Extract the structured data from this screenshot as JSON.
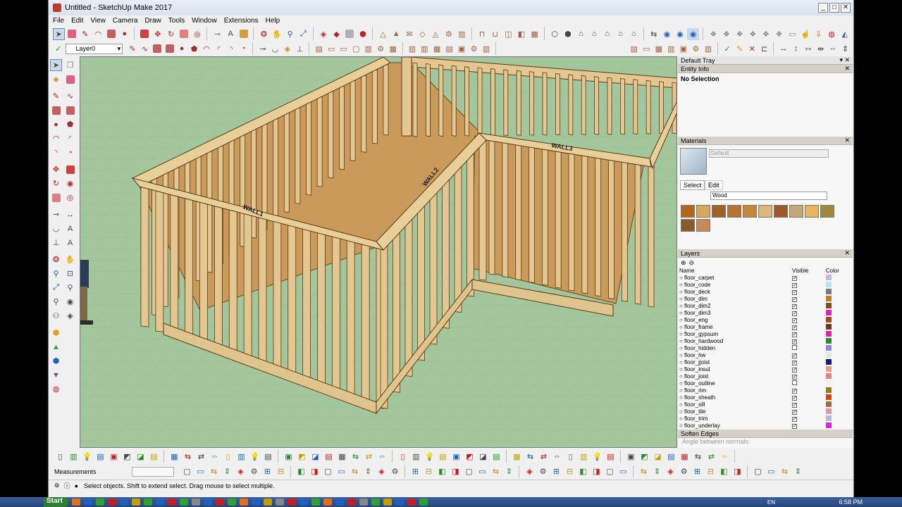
{
  "window": {
    "title": "Untitled - SketchUp Make 2017"
  },
  "menu": [
    "File",
    "Edit",
    "View",
    "Camera",
    "Draw",
    "Tools",
    "Window",
    "Extensions",
    "Help"
  ],
  "layer_toolbar": {
    "current_layer": "Layer0"
  },
  "tray": {
    "title": "Default Tray",
    "entity_info": {
      "title": "Entity Info",
      "selection": "No Selection"
    },
    "materials": {
      "title": "Materials",
      "current": "Default",
      "tabs": [
        "Select",
        "Edit"
      ],
      "collection": "Wood",
      "swatches": [
        "#b5651d",
        "#d7a85a",
        "#a0622d",
        "#b87333",
        "#c4863a",
        "#e0b67a",
        "#9c5a2b",
        "#c2a878",
        "#e8b45c",
        "#9b8a3a",
        "#8b5a2b",
        "#c98a5a"
      ]
    },
    "layers": {
      "title": "Layers",
      "col_name": "Name",
      "col_visible": "Visible",
      "col_color": "Color",
      "rows": [
        {
          "name": "floor_carpet",
          "visible": true,
          "color": "#c9b7e8"
        },
        {
          "name": "floor_code",
          "visible": true,
          "color": "#b7e8e0"
        },
        {
          "name": "floor_deck",
          "visible": true,
          "color": "#7a7a7a"
        },
        {
          "name": "floor_dim",
          "visible": true,
          "color": "#c87a2a"
        },
        {
          "name": "floor_dim2",
          "visible": true,
          "color": "#8b4a1a"
        },
        {
          "name": "floor_dim3",
          "visible": true,
          "color": "#e020c0"
        },
        {
          "name": "floor_eng",
          "visible": true,
          "color": "#a05018"
        },
        {
          "name": "floor_frame",
          "visible": true,
          "color": "#6a3a1a"
        },
        {
          "name": "floor_gypsum",
          "visible": true,
          "color": "#e020b0"
        },
        {
          "name": "floor_hardwood",
          "visible": true,
          "color": "#2a8a2a"
        },
        {
          "name": "floor_hidden",
          "visible": false,
          "color": "#8a8ad8"
        },
        {
          "name": "floor_hw",
          "visible": true,
          "color": "#e8e8e8"
        },
        {
          "name": "floor_jjoist",
          "visible": true,
          "color": "#1a1a8a"
        },
        {
          "name": "floor_insul",
          "visible": true,
          "color": "#e8a080"
        },
        {
          "name": "floor_joist",
          "visible": true,
          "color": "#f08080"
        },
        {
          "name": "floor_outline",
          "visible": false,
          "color": "#f0f0f0"
        },
        {
          "name": "floor_rim",
          "visible": true,
          "color": "#9a7a1a"
        },
        {
          "name": "floor_sheath",
          "visible": true,
          "color": "#c84a10"
        },
        {
          "name": "floor_sill",
          "visible": true,
          "color": "#a07040"
        },
        {
          "name": "floor_tile",
          "visible": true,
          "color": "#e890b0"
        },
        {
          "name": "floor_trim",
          "visible": true,
          "color": "#b8b8d8"
        },
        {
          "name": "floor_underlay",
          "visible": true,
          "color": "#e020e0"
        }
      ]
    },
    "soften": {
      "title": "Soften Edges",
      "hint": "Angle between normals:"
    }
  },
  "model_labels": {
    "wall1": "WALL1",
    "wall2": "WALL2",
    "wall3": "WALL3"
  },
  "measurements": {
    "label": "Measurements"
  },
  "status": {
    "text": "Select objects. Shift to extend select. Drag mouse to select multiple."
  },
  "taskbar": {
    "start": "Start",
    "lang": "EN",
    "time": "6:58 PM"
  }
}
